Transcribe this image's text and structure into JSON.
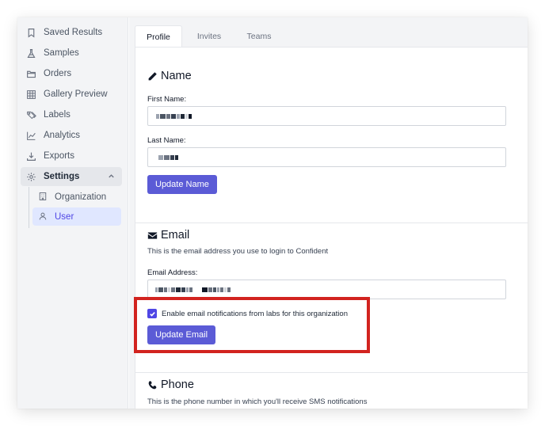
{
  "sidebar": {
    "items": [
      {
        "label": "Saved Results",
        "icon": "bookmark-icon"
      },
      {
        "label": "Samples",
        "icon": "flask-icon"
      },
      {
        "label": "Orders",
        "icon": "folder-icon"
      },
      {
        "label": "Gallery Preview",
        "icon": "grid-icon"
      },
      {
        "label": "Labels",
        "icon": "tags-icon"
      },
      {
        "label": "Analytics",
        "icon": "chart-icon"
      },
      {
        "label": "Exports",
        "icon": "download-icon"
      },
      {
        "label": "Settings",
        "icon": "gear-icon"
      }
    ],
    "settings_children": [
      {
        "label": "Organization",
        "icon": "building-icon"
      },
      {
        "label": "User",
        "icon": "user-icon"
      }
    ]
  },
  "tabs": [
    {
      "label": "Profile"
    },
    {
      "label": "Invites"
    },
    {
      "label": "Teams"
    }
  ],
  "name_section": {
    "title": "Name",
    "first_name_label": "First Name:",
    "last_name_label": "Last Name:",
    "update_button": "Update Name"
  },
  "email_section": {
    "title": "Email",
    "description": "This is the email address you use to login to Confident",
    "email_label": "Email Address:",
    "notify_checkbox_label": "Enable email notifications from labs for this organization",
    "notify_checked": true,
    "update_button": "Update Email"
  },
  "phone_section": {
    "title": "Phone",
    "description": "This is the phone number in which you'll receive SMS notifications"
  },
  "colors": {
    "accent": "#5b5bd6",
    "highlight_border": "#d2231f",
    "active_sub_bg": "#e0e7ff"
  }
}
